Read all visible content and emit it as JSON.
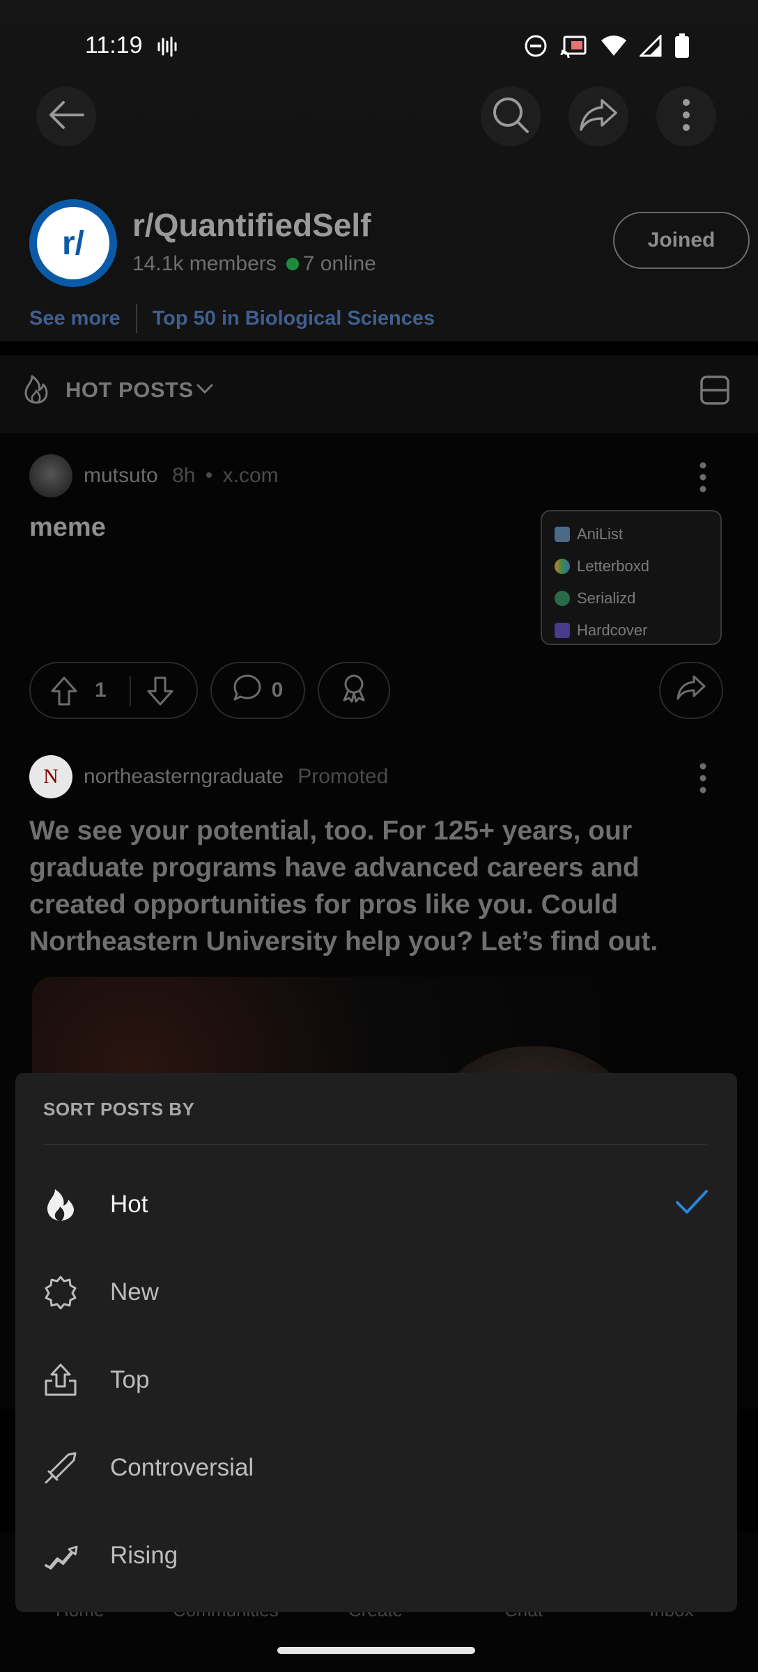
{
  "status_bar": {
    "time": "11:19"
  },
  "community": {
    "name": "r/QuantifiedSelf",
    "avatar_text": "r/",
    "members": "14.1k members",
    "online": "7 online",
    "joined_label": "Joined",
    "see_more": "See more",
    "ranking": "Top 50 in Biological Sciences"
  },
  "feed": {
    "sort_label": "HOT POSTS"
  },
  "post": {
    "username": "mutsuto",
    "age": "8h",
    "domain": "x.com",
    "separator": "•",
    "title": "meme",
    "upvotes": "1",
    "comments": "0",
    "thumbnail_items": [
      "AniList",
      "Letterboxd",
      "Serializd",
      "Hardcover"
    ]
  },
  "ad": {
    "avatar_text": "N",
    "username": "northeasterngraduate",
    "badge": "Promoted",
    "text": "We see your potential, too. For 125+ years, our graduate programs have advanced careers and created opportunities for pros like you. Could Northeastern University help you? Let’s find out."
  },
  "bottom_nav": [
    "Home",
    "Communities",
    "Create",
    "Chat",
    "Inbox"
  ],
  "sort_sheet": {
    "title": "SORT POSTS BY",
    "options": [
      {
        "label": "Hot",
        "icon": "flame-icon",
        "selected": true
      },
      {
        "label": "New",
        "icon": "new-badge-icon",
        "selected": false
      },
      {
        "label": "Top",
        "icon": "top-upload-icon",
        "selected": false
      },
      {
        "label": "Controversial",
        "icon": "sword-icon",
        "selected": false
      },
      {
        "label": "Rising",
        "icon": "trending-up-icon",
        "selected": false
      }
    ]
  },
  "colors": {
    "accent_blue": "#2a84d8",
    "online_green": "#1d8c3a",
    "sheet_bg": "#1f1f1f"
  }
}
